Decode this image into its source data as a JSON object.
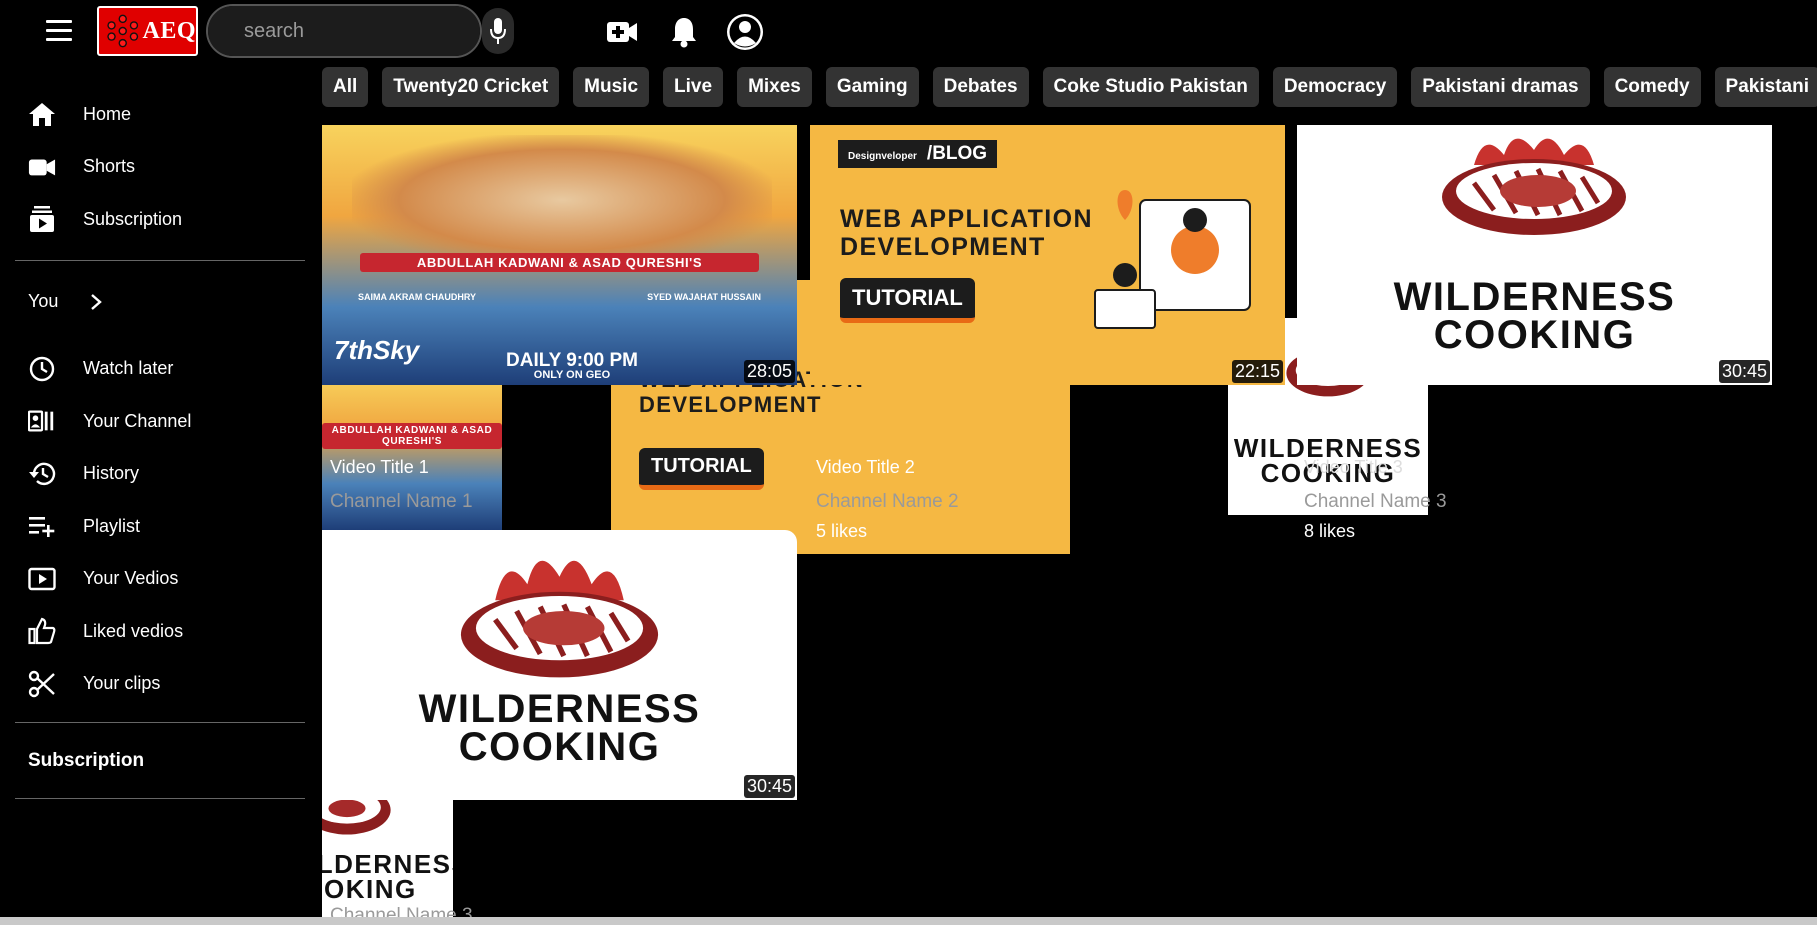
{
  "header": {
    "logo_text": "AEQ",
    "search_placeholder": "search",
    "icons": [
      "menu-icon",
      "search-icon",
      "mic-icon",
      "create-video-icon",
      "bell-icon",
      "account-icon"
    ]
  },
  "sidebar": {
    "primary": [
      {
        "label": "Home",
        "icon": "home-icon"
      },
      {
        "label": "Shorts",
        "icon": "shorts-icon"
      },
      {
        "label": "Subscription",
        "icon": "subscription-icon"
      }
    ],
    "you_label": "You",
    "secondary": [
      {
        "label": "Watch later",
        "icon": "clock-icon"
      },
      {
        "label": "Your Channel",
        "icon": "channel-icon"
      },
      {
        "label": "History",
        "icon": "history-icon"
      },
      {
        "label": "Playlist",
        "icon": "playlist-add-icon"
      },
      {
        "label": "Your Vedios",
        "icon": "play-icon"
      },
      {
        "label": "Liked vedios",
        "icon": "thumbs-up-icon"
      },
      {
        "label": "Your clips",
        "icon": "scissors-icon"
      }
    ],
    "subscription_heading": "Subscription"
  },
  "chips": [
    "All",
    "Twenty20 Cricket",
    "Music",
    "Live",
    "Mixes",
    "Gaming",
    "Debates",
    "Coke Studio Pakistan",
    "Democracy",
    "Pakistani dramas",
    "Comedy",
    "Pakistani"
  ],
  "videos": {
    "v1": {
      "title": "Video Title 1",
      "channel": "Channel Name 1",
      "duration": "28:05",
      "thumb_banner": "ABDULLAH KADWANI & ASAD QURESHI'S",
      "thumb_footer": "DAILY 9:00 PM",
      "thumb_footer2": "ONLY ON GEO",
      "thumb_brand": "7thSky",
      "thumb_credit_left": "SAIMA AKRAM CHAUDHRY",
      "thumb_credit_right": "SYED WAJAHAT HUSSAIN"
    },
    "v2": {
      "title": "Video Title 2",
      "channel": "Channel Name 2",
      "likes": "5 likes",
      "duration": "22:15",
      "thumb_blog": "/BLOG",
      "thumb_brand": "Designveloper",
      "thumb_headline_1": "WEB APPLICATION",
      "thumb_headline_2": "DEVELOPMENT",
      "thumb_button": "TUTORIAL"
    },
    "v3": {
      "title": "Video Title 3",
      "channel": "Channel Name 3",
      "likes": "8 likes",
      "duration": "30:45",
      "thumb_line_1": "WILDERNESS",
      "thumb_line_2": "COOKING"
    },
    "v4": {
      "channel": "Channel Name 3",
      "duration": "30:45",
      "thumb_line_1": "WILDERNESS",
      "thumb_line_2": "COOKING"
    }
  },
  "colors": {
    "background": "#000000",
    "chip_bg": "#333333",
    "logo_red": "#e00000",
    "channel_text": "#9a9a9a"
  }
}
